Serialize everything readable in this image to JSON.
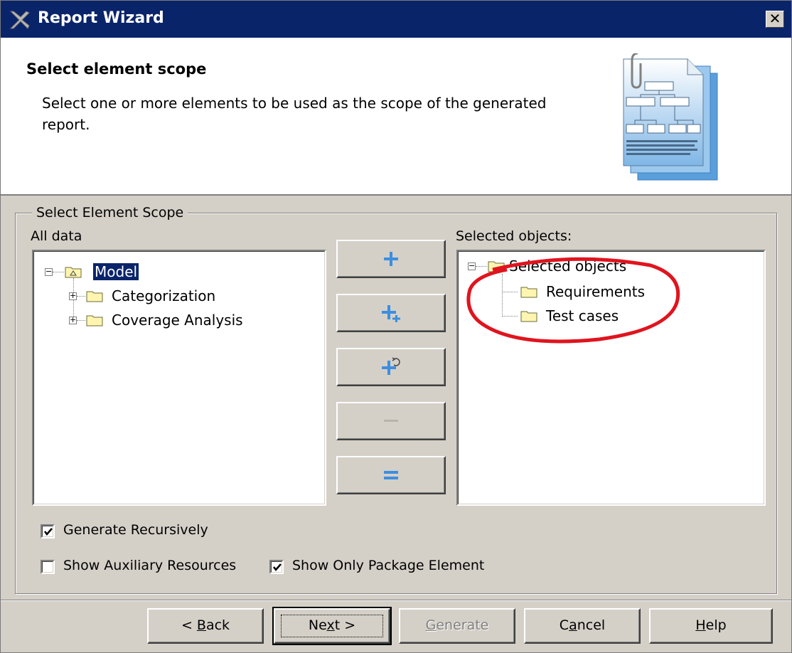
{
  "window": {
    "title": "Report Wizard",
    "close_glyph": "✕"
  },
  "header": {
    "title": "Select element scope",
    "description": "Select one or more elements to be used as the scope of the generated report."
  },
  "group": {
    "label": "Select Element Scope"
  },
  "left_panel": {
    "label": "All data",
    "tree": [
      {
        "label": "Model",
        "icon": "model-package-icon",
        "selected": true,
        "expanded": true
      },
      {
        "label": "Categorization",
        "icon": "folder-icon",
        "selected": false,
        "expanded": false
      },
      {
        "label": "Coverage Analysis",
        "icon": "folder-icon",
        "selected": false,
        "expanded": false
      }
    ]
  },
  "right_panel": {
    "label": "Selected objects:",
    "tree": [
      {
        "label": "Selected objects",
        "icon": "folder-icon",
        "expanded": true
      },
      {
        "label": "Requirements",
        "icon": "folder-icon"
      },
      {
        "label": "Test cases",
        "icon": "folder-icon"
      }
    ]
  },
  "middle_buttons": [
    {
      "name": "add-button",
      "icon": "plus-icon",
      "enabled": true
    },
    {
      "name": "add-recursive-button",
      "icon": "plus-small-plus-icon",
      "enabled": true
    },
    {
      "name": "add-with-children-button",
      "icon": "plus-cycle-icon",
      "enabled": true
    },
    {
      "name": "remove-button",
      "icon": "minus-icon",
      "enabled": false
    },
    {
      "name": "remove-all-button",
      "icon": "equals-icon",
      "enabled": true
    }
  ],
  "options": {
    "generate_recursively": {
      "label": "Generate Recursively",
      "checked": true
    },
    "show_auxiliary": {
      "label": "Show Auxiliary Resources",
      "checked": false
    },
    "show_only_package": {
      "label": "Show Only Package Element",
      "checked": true
    }
  },
  "buttons": {
    "back": {
      "pre": "< ",
      "mnemonic": "B",
      "post": "ack"
    },
    "next": {
      "pre": "Ne",
      "mnemonic": "x",
      "post": "t >"
    },
    "generate": {
      "pre": "",
      "mnemonic": "G",
      "post": "enerate"
    },
    "cancel": {
      "pre": "C",
      "mnemonic": "a",
      "post": "ncel"
    },
    "help": {
      "pre": "",
      "mnemonic": "H",
      "post": "elp"
    }
  },
  "colors": {
    "titlebar": "#0a246a",
    "dialog_bg": "#d4d0c8",
    "button_icon_blue": "#3c8ee0",
    "annotation_red": "#e0141e"
  }
}
